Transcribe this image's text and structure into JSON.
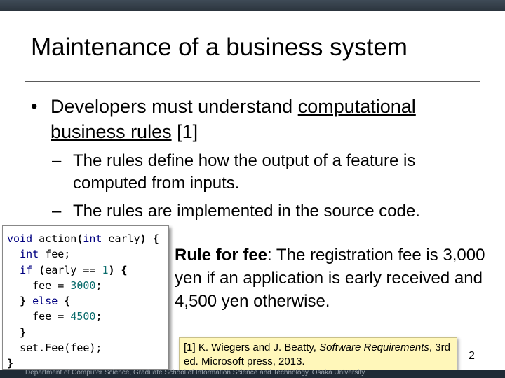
{
  "slide": {
    "title": "Maintenance of a business system",
    "bullet": {
      "marker": "•",
      "text_before": "Developers must understand ",
      "underlined": "computational business rules",
      "text_after": " [1]"
    },
    "sub_bullets": [
      {
        "marker": "–",
        "text": "The rules define how the output of a feature is computed from inputs."
      },
      {
        "marker": "–",
        "text": "The rules are implemented in the source code."
      }
    ],
    "code": {
      "l1": {
        "kw": "void",
        "name": " action",
        "p1": "(",
        "kw2": "int",
        "rest": " early",
        "p2": ") {"
      },
      "l2": {
        "indent": "  ",
        "kw": "int",
        "rest": " fee;"
      },
      "l3": {
        "indent": "  ",
        "kw": "if",
        "p1": " (",
        "rest": "early == ",
        "num": "1",
        "p2": ") {"
      },
      "l4": {
        "indent": "    ",
        "rest": "fee = ",
        "num": "3000",
        "end": ";"
      },
      "l5": {
        "indent": "  ",
        "p1": "} ",
        "kw": "else",
        "p2": " {"
      },
      "l6": {
        "indent": "    ",
        "rest": "fee = ",
        "num": "4500",
        "end": ";"
      },
      "l7": {
        "indent": "  ",
        "p1": "}"
      },
      "l8": {
        "indent": "  ",
        "rest": "set.Fee(fee);"
      },
      "l9": {
        "p1": "}"
      }
    },
    "rule_for_fee": {
      "bold": "Rule for fee",
      "text": ": The registration fee is 3,000 yen if an application is early received and 4,500 yen otherwise."
    },
    "reference": {
      "before": "[1] K. Wiegers and J. Beatty, ",
      "italic": "Software Requirements",
      "after": ", 3rd ed. Microsoft press, 2013."
    },
    "page_number": "2",
    "footer": "Department of Computer Science, Graduate School of Information Science and Technology, Osaka University"
  }
}
